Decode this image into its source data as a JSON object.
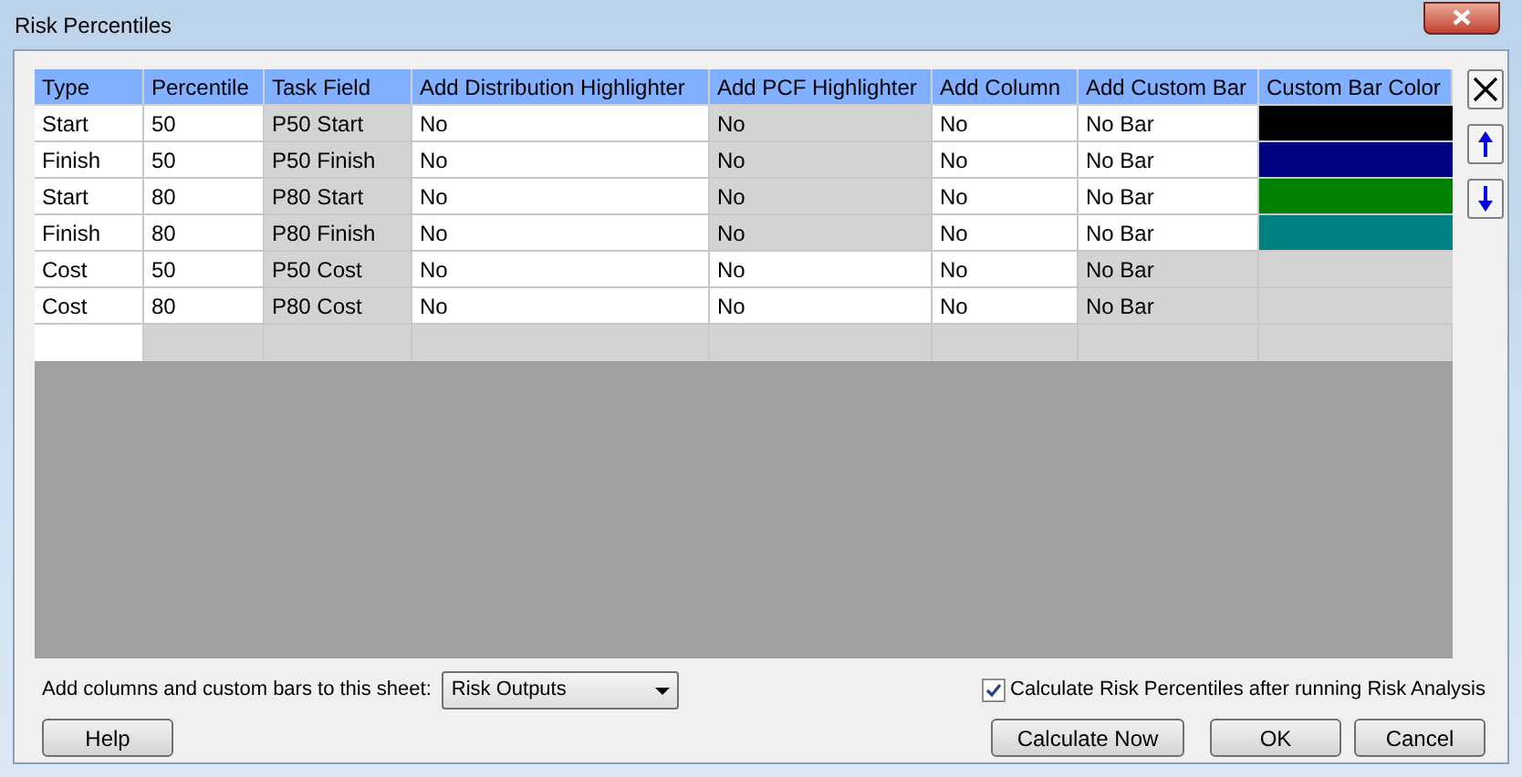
{
  "window": {
    "title": "Risk Percentiles"
  },
  "table": {
    "columns": [
      "Type",
      "Percentile",
      "Task Field",
      "Add Distribution Highlighter",
      "Add PCF Highlighter",
      "Add Column",
      "Add Custom Bar",
      "Custom Bar Color"
    ],
    "rows": [
      {
        "cells": [
          {
            "text": "Start",
            "readonly": false
          },
          {
            "text": "50",
            "readonly": false
          },
          {
            "text": "P50 Start",
            "readonly": true
          },
          {
            "text": "No",
            "readonly": false
          },
          {
            "text": "No",
            "readonly": true
          },
          {
            "text": "No",
            "readonly": false
          },
          {
            "text": "No Bar",
            "readonly": false
          }
        ],
        "color": "#000000"
      },
      {
        "cells": [
          {
            "text": "Finish",
            "readonly": false
          },
          {
            "text": "50",
            "readonly": false
          },
          {
            "text": "P50 Finish",
            "readonly": true
          },
          {
            "text": "No",
            "readonly": false
          },
          {
            "text": "No",
            "readonly": true
          },
          {
            "text": "No",
            "readonly": false
          },
          {
            "text": "No Bar",
            "readonly": false
          }
        ],
        "color": "#000080"
      },
      {
        "cells": [
          {
            "text": "Start",
            "readonly": false
          },
          {
            "text": "80",
            "readonly": false
          },
          {
            "text": "P80 Start",
            "readonly": true
          },
          {
            "text": "No",
            "readonly": false
          },
          {
            "text": "No",
            "readonly": true
          },
          {
            "text": "No",
            "readonly": false
          },
          {
            "text": "No Bar",
            "readonly": false
          }
        ],
        "color": "#008000"
      },
      {
        "cells": [
          {
            "text": "Finish",
            "readonly": false
          },
          {
            "text": "80",
            "readonly": false
          },
          {
            "text": "P80 Finish",
            "readonly": true
          },
          {
            "text": "No",
            "readonly": false
          },
          {
            "text": "No",
            "readonly": true
          },
          {
            "text": "No",
            "readonly": false
          },
          {
            "text": "No Bar",
            "readonly": false
          }
        ],
        "color": "#008080"
      },
      {
        "cells": [
          {
            "text": "Cost",
            "readonly": false
          },
          {
            "text": "50",
            "readonly": false
          },
          {
            "text": "P50 Cost",
            "readonly": true
          },
          {
            "text": "No",
            "readonly": false
          },
          {
            "text": "No",
            "readonly": false
          },
          {
            "text": "No",
            "readonly": false
          },
          {
            "text": "No Bar",
            "readonly": true
          }
        ]
      },
      {
        "cells": [
          {
            "text": "Cost",
            "readonly": false
          },
          {
            "text": "80",
            "readonly": false
          },
          {
            "text": "P80 Cost",
            "readonly": true
          },
          {
            "text": "No",
            "readonly": false
          },
          {
            "text": "No",
            "readonly": false
          },
          {
            "text": "No",
            "readonly": false
          },
          {
            "text": "No Bar",
            "readonly": true
          }
        ]
      }
    ]
  },
  "sheet": {
    "label": "Add columns and custom bars to this sheet:",
    "value": "Risk Outputs"
  },
  "calculate_after": {
    "label": "Calculate Risk Percentiles after running Risk Analysis",
    "checked": true
  },
  "buttons": {
    "help": "Help",
    "calculate": "Calculate Now",
    "ok": "OK",
    "cancel": "Cancel"
  }
}
